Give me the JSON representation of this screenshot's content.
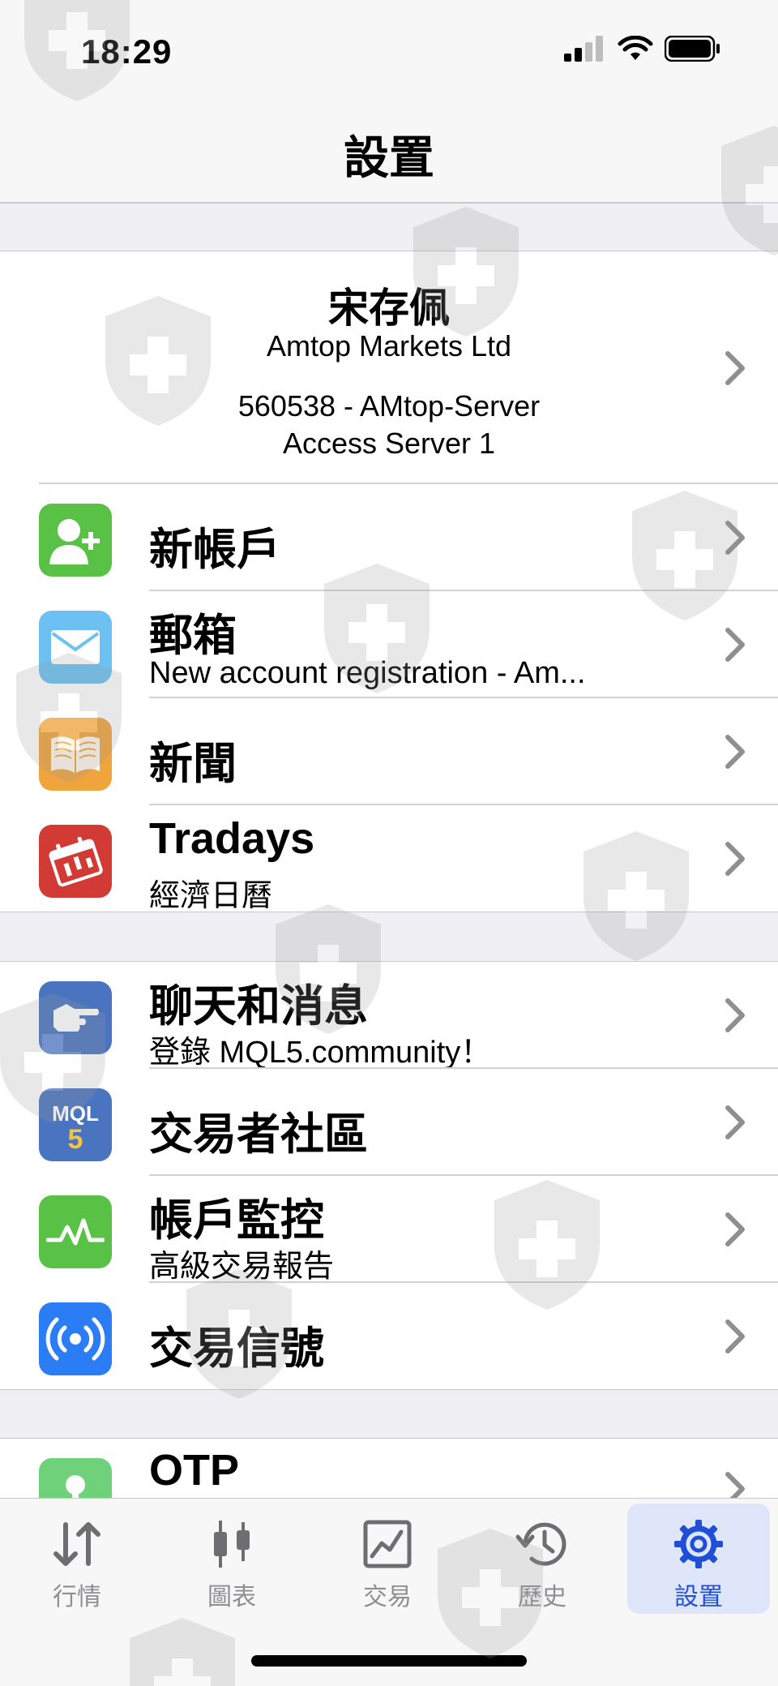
{
  "status_bar": {
    "time": "18:29"
  },
  "nav": {
    "title": "設置"
  },
  "account": {
    "name": "宋存佩",
    "company": "Amtop Markets Ltd",
    "login": "560538 - AMtop-Server",
    "server": "Access Server 1"
  },
  "menu": {
    "new_account": {
      "title": "新帳戶"
    },
    "mailbox": {
      "title": "郵箱",
      "subtitle": "New account registration - Am..."
    },
    "news": {
      "title": "新聞"
    },
    "tradays": {
      "title": "Tradays",
      "subtitle": "經濟日曆"
    },
    "chat": {
      "title": "聊天和消息",
      "subtitle": "登錄 MQL5.community！"
    },
    "community": {
      "title": "交易者社區",
      "icon_text": "MQL5"
    },
    "monitoring": {
      "title": "帳戶監控",
      "subtitle": "高級交易報告"
    },
    "signals": {
      "title": "交易信號"
    },
    "otp": {
      "title": "OTP"
    }
  },
  "tabs": [
    {
      "label": "行情",
      "icon": "quotes-icon"
    },
    {
      "label": "圖表",
      "icon": "chart-icon"
    },
    {
      "label": "交易",
      "icon": "trade-icon"
    },
    {
      "label": "歷史",
      "icon": "history-icon"
    },
    {
      "label": "設置",
      "icon": "settings-icon",
      "active": true
    }
  ],
  "colors": {
    "accent": "#1f4fd9",
    "green": "#5ac147",
    "mail_blue": "#6cc0f2",
    "orange": "#f0a43c",
    "red": "#d23a35",
    "chat_blue": "#4b74c0",
    "bright_blue": "#2b7df6"
  }
}
